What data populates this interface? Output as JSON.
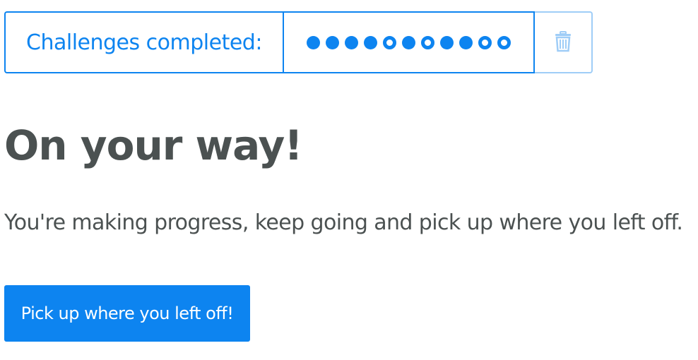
{
  "progress": {
    "label": "Challenges completed:",
    "completed_pattern": [
      true,
      true,
      true,
      true,
      false,
      true,
      false,
      true,
      true,
      false,
      false
    ],
    "completed_count": 7,
    "total_count": 11,
    "trash_icon": "trash-icon"
  },
  "main": {
    "headline": "On your way!",
    "subtext": "You're making progress, keep going and pick up where you left off.",
    "resume_button_label": "Pick up where you left off!"
  },
  "colors": {
    "accent": "#0d84f0",
    "accent_light": "#9fcdf7",
    "text": "#4b5151"
  }
}
